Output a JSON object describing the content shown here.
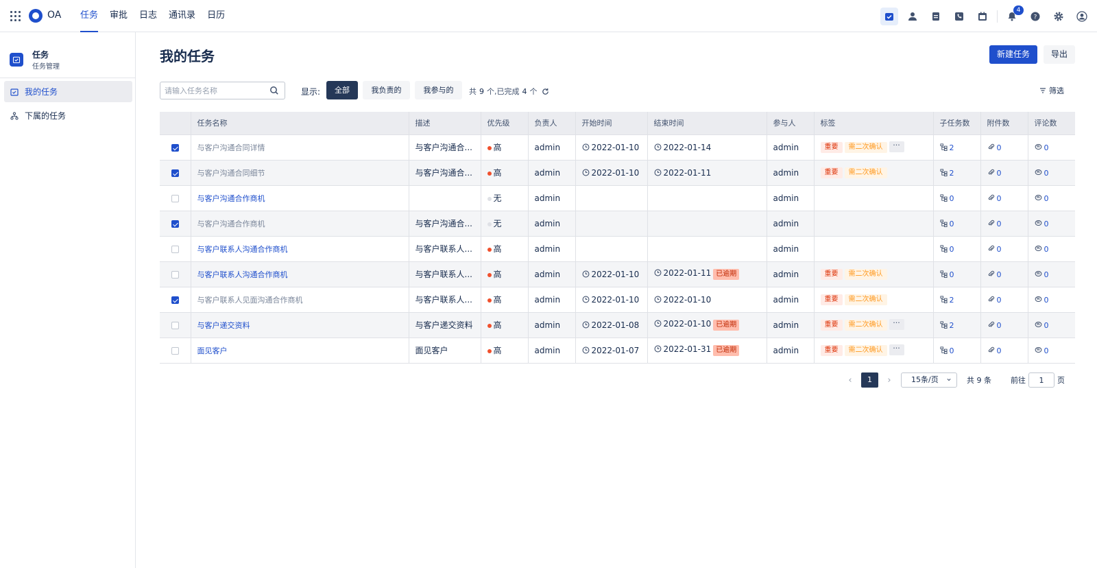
{
  "app": {
    "brand": "OA"
  },
  "nav": [
    "任务",
    "审批",
    "日志",
    "通讯录",
    "日历"
  ],
  "notifications": {
    "count": "4"
  },
  "sidebar": {
    "title": "任务",
    "subtitle": "任务管理",
    "items": [
      "我的任务",
      "下属的任务"
    ]
  },
  "page": {
    "title": "我的任务",
    "new_button": "新建任务",
    "export_button": "导出"
  },
  "toolbar": {
    "search_placeholder": "请输入任务名称",
    "show_label": "显示:",
    "segments": [
      "全部",
      "我负责的",
      "我参与的"
    ],
    "summary_prefix": "共",
    "summary_total": "9",
    "summary_mid": "个,已完成",
    "summary_done": "4",
    "summary_suffix": "个",
    "filter_label": "筛选"
  },
  "table": {
    "columns": [
      "任务名称",
      "描述",
      "优先级",
      "负责人",
      "开始时间",
      "结束时间",
      "参与人",
      "标签",
      "子任务数",
      "附件数",
      "评论数"
    ],
    "rows": [
      {
        "checked": true,
        "name": "与客户沟通合同详情",
        "desc": "与客户沟通合...",
        "priority": "高",
        "owner": "admin",
        "start": "2022-01-10",
        "end": "2022-01-14",
        "overdue": "",
        "participant": "admin",
        "tags": [
          "重要",
          "需二次确认"
        ],
        "more": true,
        "subtasks": "2",
        "attachments": "0",
        "comments": "0"
      },
      {
        "checked": true,
        "name": "与客户沟通合同细节",
        "desc": "与客户沟通合...",
        "priority": "高",
        "owner": "admin",
        "start": "2022-01-10",
        "end": "2022-01-11",
        "overdue": "",
        "participant": "admin",
        "tags": [
          "重要",
          "需二次确认"
        ],
        "more": false,
        "subtasks": "2",
        "attachments": "0",
        "comments": "0"
      },
      {
        "checked": false,
        "name": "与客户沟通合作商机",
        "desc": "",
        "priority": "无",
        "owner": "admin",
        "start": "",
        "end": "",
        "overdue": "",
        "participant": "admin",
        "tags": [],
        "more": false,
        "subtasks": "0",
        "attachments": "0",
        "comments": "0"
      },
      {
        "checked": true,
        "name": "与客户沟通合作商机",
        "desc": "与客户沟通合...",
        "priority": "无",
        "owner": "admin",
        "start": "",
        "end": "",
        "overdue": "",
        "participant": "admin",
        "tags": [],
        "more": false,
        "subtasks": "0",
        "attachments": "0",
        "comments": "0"
      },
      {
        "checked": false,
        "name": "与客户联系人沟通合作商机",
        "desc": "与客户联系人...",
        "priority": "高",
        "owner": "admin",
        "start": "",
        "end": "",
        "overdue": "",
        "participant": "admin",
        "tags": [],
        "more": false,
        "subtasks": "0",
        "attachments": "0",
        "comments": "0"
      },
      {
        "checked": false,
        "name": "与客户联系人沟通合作商机",
        "desc": "与客户联系人...",
        "priority": "高",
        "owner": "admin",
        "start": "2022-01-10",
        "end": "2022-01-11",
        "overdue": "已逾期",
        "participant": "admin",
        "tags": [
          "重要",
          "需二次确认"
        ],
        "more": false,
        "subtasks": "0",
        "attachments": "0",
        "comments": "0"
      },
      {
        "checked": true,
        "name": "与客户联系人见面沟通合作商机",
        "desc": "与客户联系人...",
        "priority": "高",
        "owner": "admin",
        "start": "2022-01-10",
        "end": "2022-01-10",
        "overdue": "",
        "participant": "admin",
        "tags": [
          "重要",
          "需二次确认"
        ],
        "more": false,
        "subtasks": "2",
        "attachments": "0",
        "comments": "0"
      },
      {
        "checked": false,
        "name": "与客户递交资料",
        "desc": "与客户递交资料",
        "priority": "高",
        "owner": "admin",
        "start": "2022-01-08",
        "end": "2022-01-10",
        "overdue": "已逾期",
        "participant": "admin",
        "tags": [
          "重要",
          "需二次确认"
        ],
        "more": true,
        "subtasks": "2",
        "attachments": "0",
        "comments": "0"
      },
      {
        "checked": false,
        "name": "面见客户",
        "desc": "面见客户",
        "priority": "高",
        "owner": "admin",
        "start": "2022-01-07",
        "end": "2022-01-31",
        "overdue": "已逾期",
        "participant": "admin",
        "tags": [
          "重要",
          "需二次确认"
        ],
        "more": true,
        "subtasks": "0",
        "attachments": "0",
        "comments": "0"
      }
    ]
  },
  "pagination": {
    "current": "1",
    "page_size": "15条/页",
    "total_text": "共 9 条",
    "goto_label": "前往",
    "goto_value": "1",
    "page_suffix": "页"
  },
  "colors": {
    "primary": "#1f4fcc",
    "high": "#f0502d",
    "none": "#dfe1e6",
    "dark": "#253858"
  }
}
